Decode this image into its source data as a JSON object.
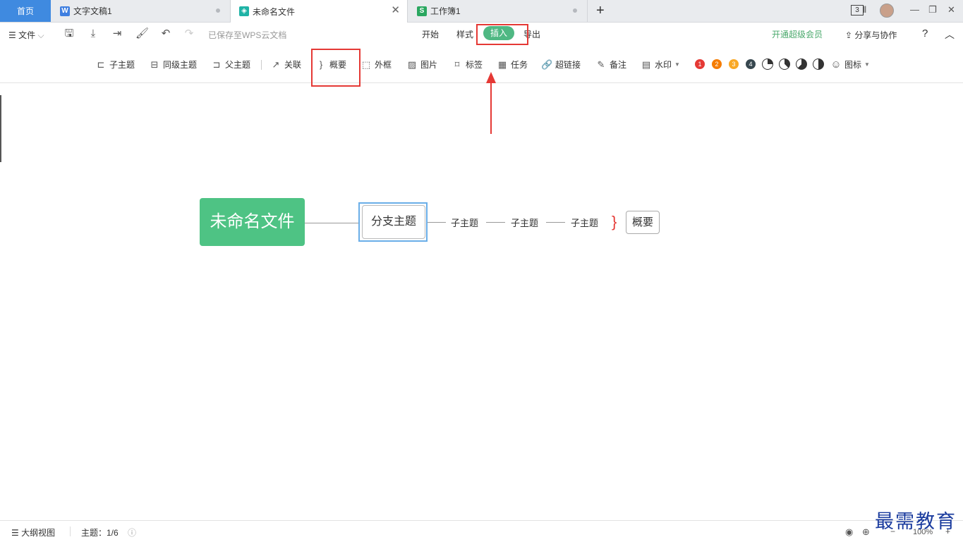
{
  "tabs": {
    "home": "首页",
    "doc1": "文字文稿1",
    "doc2": "未命名文件",
    "doc3": "工作簿1",
    "doc_count": "3"
  },
  "menu": {
    "file": "文件",
    "saved": "已保存至WPS云文档",
    "tab_start": "开始",
    "tab_style": "样式",
    "tab_insert": "插入",
    "tab_export": "导出",
    "vip": "开通超级会员",
    "share": "分享与协作"
  },
  "ribbon": {
    "child": "子主题",
    "sibling": "同级主题",
    "parent": "父主题",
    "relation": "关联",
    "summary": "概要",
    "frame": "外框",
    "image": "图片",
    "tag": "标签",
    "task": "任务",
    "link": "超链接",
    "note": "备注",
    "watermark": "水印",
    "icons": "图标",
    "priority": [
      "1",
      "2",
      "3",
      "4"
    ]
  },
  "mindmap": {
    "root": "未命名文件",
    "branch": "分支主题",
    "subs": [
      "子主题",
      "子主题",
      "子主题"
    ],
    "summary": "概要"
  },
  "status": {
    "outline": "大纲视图",
    "topics": "主题：1/6",
    "zoom": "100%"
  },
  "brand_watermark": "最需教育",
  "colors": {
    "accent_green": "#4fb883",
    "home_tab_blue": "#3f8ae0",
    "annotation_red": "#e53935",
    "selection_blue": "#6aaee8"
  }
}
